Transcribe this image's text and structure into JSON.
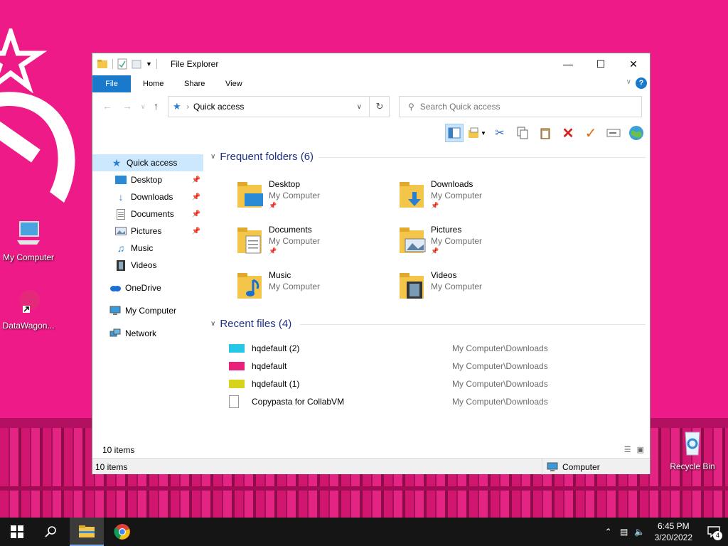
{
  "desktop": {
    "icons": [
      {
        "label": "My Computer",
        "icon": "computer-icon"
      },
      {
        "label": "DataWagon...",
        "icon": "datawagon-shortcut-icon"
      },
      {
        "label": "Recycle Bin",
        "icon": "recycle-bin-icon"
      }
    ]
  },
  "window": {
    "title": "File Explorer",
    "ribbon_tabs": [
      "File",
      "Home",
      "Share",
      "View"
    ],
    "address": "Quick access",
    "search_placeholder": "Search Quick access",
    "nav": {
      "quick_access": "Quick access",
      "pinned": [
        "Desktop",
        "Downloads",
        "Documents",
        "Pictures"
      ],
      "unpinned": [
        "Music",
        "Videos"
      ],
      "onedrive": "OneDrive",
      "computer": "My Computer",
      "network": "Network"
    },
    "frequent": {
      "header": "Frequent folders (6)",
      "folders": [
        {
          "name": "Desktop",
          "location": "My Computer"
        },
        {
          "name": "Downloads",
          "location": "My Computer"
        },
        {
          "name": "Documents",
          "location": "My Computer"
        },
        {
          "name": "Pictures",
          "location": "My Computer"
        },
        {
          "name": "Music",
          "location": "My Computer"
        },
        {
          "name": "Videos",
          "location": "My Computer"
        }
      ]
    },
    "recent": {
      "header": "Recent files (4)",
      "files": [
        {
          "name": "hqdefault (2)",
          "path": "My Computer\\Downloads",
          "color": "#25c7e6"
        },
        {
          "name": "hqdefault",
          "path": "My Computer\\Downloads",
          "color": "#e8207c"
        },
        {
          "name": "hqdefault (1)",
          "path": "My Computer\\Downloads",
          "color": "#d7d31c"
        },
        {
          "name": "Copypasta for CollabVM",
          "path": "My Computer\\Downloads",
          "color": "#ffffff"
        }
      ]
    },
    "item_count": "10 items",
    "status": {
      "left": "10 items",
      "right": "Computer"
    }
  },
  "taskbar": {
    "time": "6:45 PM",
    "date": "3/20/2022",
    "notification_count": "4"
  },
  "colors": {
    "accent": "#1979ca",
    "desktop_bg": "#ee1a87",
    "group_header": "#1e3287"
  }
}
